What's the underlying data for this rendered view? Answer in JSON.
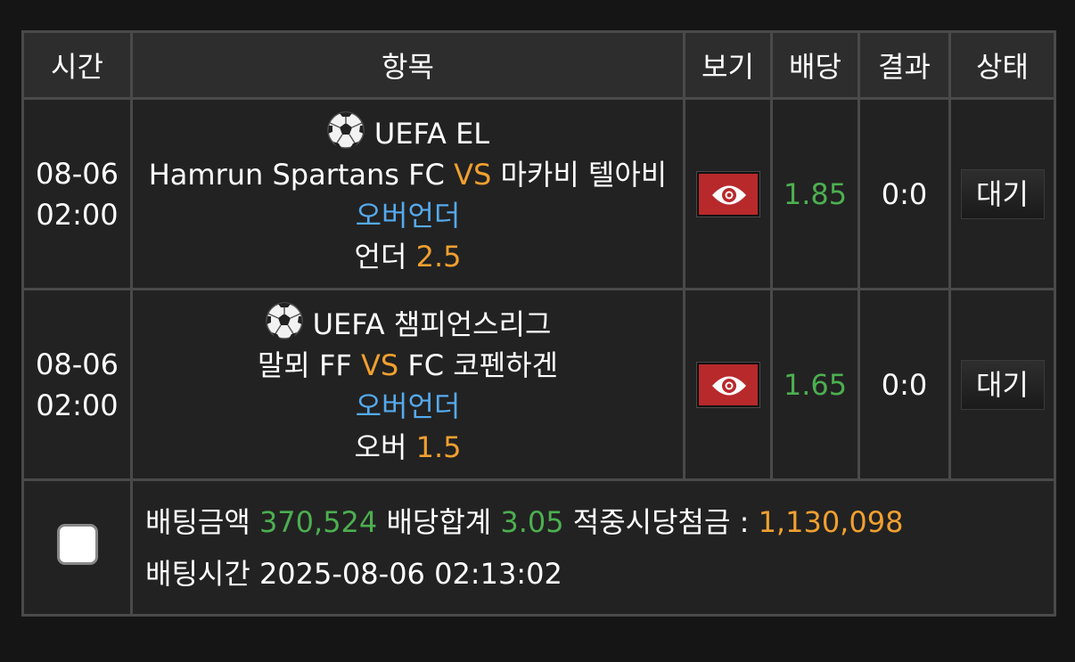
{
  "header": {
    "time": "시간",
    "item": "항목",
    "view": "보기",
    "odds": "배당",
    "result": "결과",
    "status": "상태"
  },
  "bets": [
    {
      "date": "08-06",
      "time": "02:00",
      "league": "UEFA EL",
      "home": "Hamrun Spartans FC",
      "vs": "VS",
      "away": "마카비 텔아비",
      "market": "오버언더",
      "pick_label": "언더",
      "pick_value": "2.5",
      "odds": "1.85",
      "result": "0:0",
      "status": "대기",
      "view_icon": "eye-icon"
    },
    {
      "date": "08-06",
      "time": "02:00",
      "league": "UEFA 챔피언스리그",
      "home": "말뫼 FF",
      "vs": "VS",
      "away": "FC 코펜하겐",
      "market": "오버언더",
      "pick_label": "오버",
      "pick_value": "1.5",
      "odds": "1.65",
      "result": "0:0",
      "status": "대기",
      "view_icon": "eye-icon"
    }
  ],
  "summary": {
    "bet_amount_label": "배팅금액",
    "bet_amount": "370,524",
    "odds_total_label": "배당합계",
    "odds_total": "3.05",
    "payout_label": "적중시당첨금 :",
    "payout": "1,130,098",
    "bet_time_label": "배팅시간",
    "bet_time": "2025-08-06 02:13:02"
  },
  "colors": {
    "background": "#151515",
    "header_bg": "#2d2d2d",
    "cell_bg": "#222222",
    "border": "#4a4a4a",
    "vs_orange": "#f0a030",
    "market_blue": "#55aaee",
    "odds_green": "#4caf50",
    "view_button_red": "#b8292b"
  }
}
